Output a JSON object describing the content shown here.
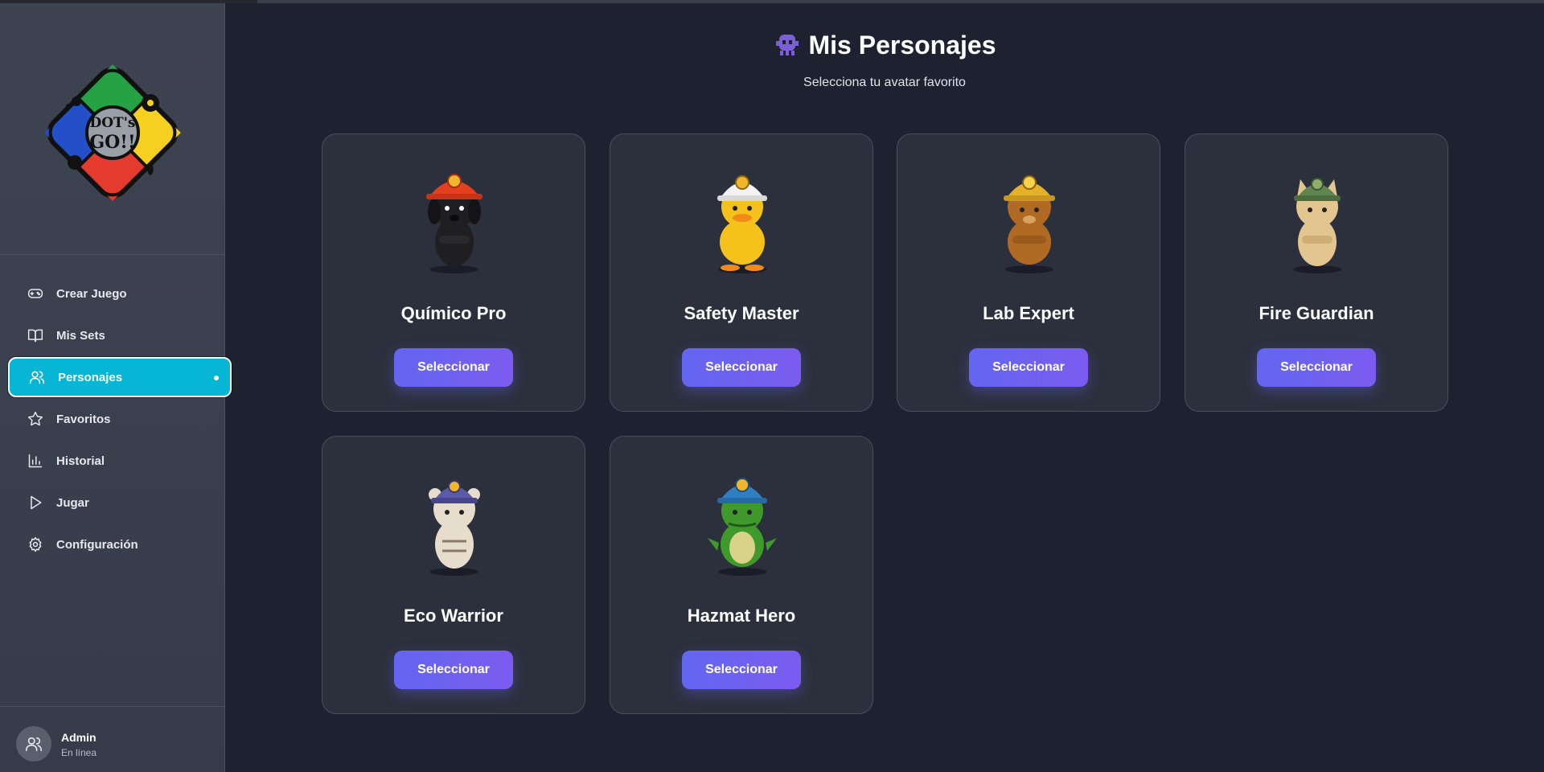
{
  "sidebar": {
    "logo": {
      "text_top": "DOT's",
      "text_bottom": "GO!!",
      "icon": "dots-go-logo"
    },
    "items": [
      {
        "label": "Crear Juego",
        "icon": "gamepad-icon",
        "active": false
      },
      {
        "label": "Mis Sets",
        "icon": "book-open-icon",
        "active": false
      },
      {
        "label": "Personajes",
        "icon": "users-icon",
        "active": true
      },
      {
        "label": "Favoritos",
        "icon": "star-icon",
        "active": false
      },
      {
        "label": "Historial",
        "icon": "bar-chart-icon",
        "active": false
      },
      {
        "label": "Jugar",
        "icon": "play-icon",
        "active": false
      },
      {
        "label": "Configuración",
        "icon": "gear-icon",
        "active": false
      }
    ],
    "user": {
      "name": "Admin",
      "status": "En línea",
      "icon": "users-icon"
    }
  },
  "main": {
    "title": "Mis Personajes",
    "title_icon": "alien-monster-icon",
    "subtitle": "Selecciona tu avatar favorito",
    "characters": [
      {
        "name": "Químico Pro",
        "button": "Seleccionar",
        "image": "black-dog-red-helmet",
        "body": "#1f1f22",
        "helmet": "#e2401e"
      },
      {
        "name": "Safety Master",
        "button": "Seleccionar",
        "image": "yellow-duck-white-helmet",
        "body": "#f4c21a",
        "helmet": "#f2f2f2"
      },
      {
        "name": "Lab Expert",
        "button": "Seleccionar",
        "image": "brown-cat-yellow-helmet",
        "body": "#b06a24",
        "helmet": "#e5b02a"
      },
      {
        "name": "Fire Guardian",
        "button": "Seleccionar",
        "image": "beige-cat-green-helmet",
        "body": "#e2c58f",
        "helmet": "#5f8550"
      },
      {
        "name": "Eco Warrior",
        "button": "Seleccionar",
        "image": "white-tiger-purple-helmet",
        "body": "#e7ddcc",
        "helmet": "#5a5aa8"
      },
      {
        "name": "Hazmat Hero",
        "button": "Seleccionar",
        "image": "green-crocodile-blue-helmet",
        "body": "#3f9a2b",
        "helmet": "#2f7fc2"
      }
    ]
  },
  "colors": {
    "accent": "#06b6d4",
    "button": "#6366f1",
    "background": "#1e2230",
    "sidebar": "#3e4352",
    "card": "#2c303d"
  }
}
